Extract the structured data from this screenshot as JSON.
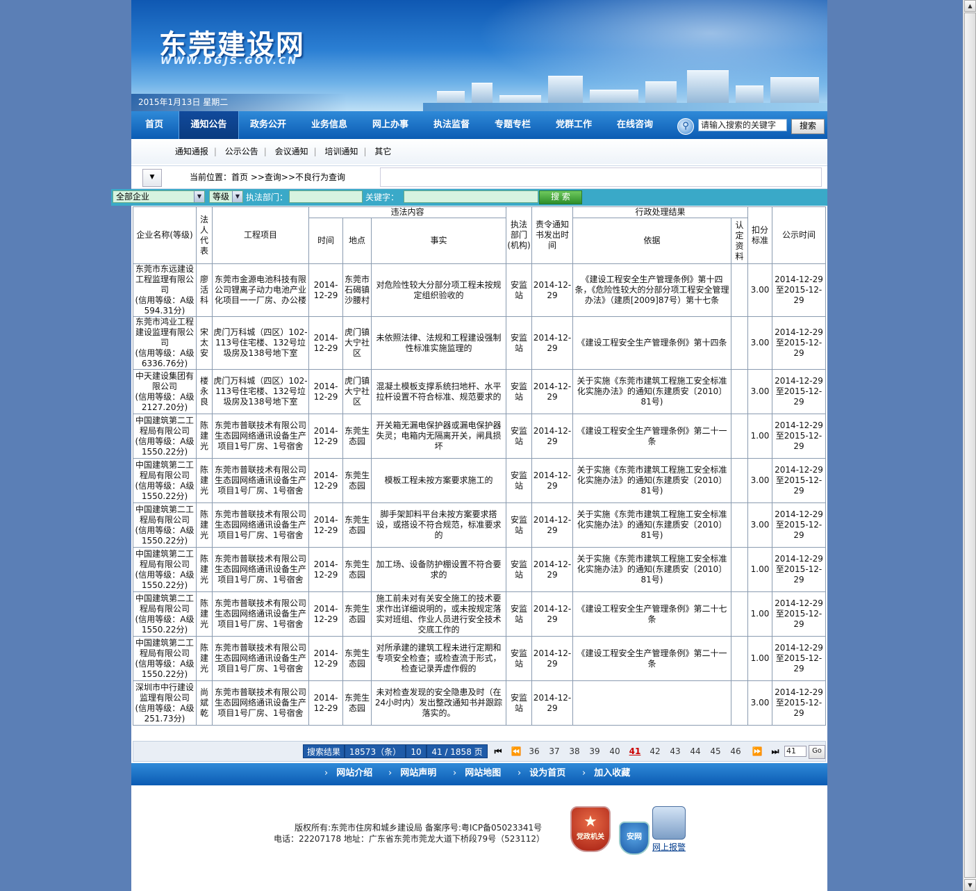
{
  "header": {
    "site_title": "东莞建设网",
    "site_url": "WWW.DGJS.GOV.CN",
    "date": "2015年1月13日 星期二"
  },
  "nav": {
    "items": [
      "首页",
      "通知公告",
      "政务公开",
      "业务信息",
      "网上办事",
      "执法监督",
      "专题专栏",
      "党群工作",
      "在线咨询"
    ],
    "active": "通知公告",
    "search_placeholder": "请输入搜索的关键字",
    "search_button": "搜索"
  },
  "subnav": {
    "items": [
      "通知通报",
      "公示公告",
      "会议通知",
      "培训通知",
      "其它"
    ]
  },
  "breadcrumb": {
    "text": "当前位置：首页 >>查询>>不良行为查询"
  },
  "filter": {
    "company_select": "全部企业",
    "grade_select": "等级",
    "dept_label": "执法部门：",
    "keyword_label": "关键字：",
    "search_button": "搜 索"
  },
  "table": {
    "headers": {
      "company": "企业名称(等级)",
      "legal_rep": "法人代表",
      "project": "工程项目",
      "violation": "违法内容",
      "time": "时间",
      "place": "地点",
      "fact": "事实",
      "dept": "执法部门(机构)",
      "notice_date": "责令通知书发出时间",
      "admin_result": "行政处理结果",
      "basis": "依据",
      "confirm": "认定资料",
      "deduct": "扣分标准",
      "publish": "公示时间"
    },
    "rows": [
      {
        "company": "东莞市东远建设工程监理有限公司",
        "grade": "(信用等级：A级594.31分)",
        "rep": "廖活科",
        "project": "东莞市金源电池科技有限公司锂离子动力电池产业化项目一一厂房、办公楼",
        "time": "2014-12-29",
        "place": "东莞市石碣镇沙腰村",
        "fact": "对危险性较大分部分项工程未按规定组织验收的",
        "dept": "安监站",
        "notice": "2014-12-29",
        "basis": "《建设工程安全生产管理条例》第十四条，《危险性较大的分部分项工程安全管理办法》（建质[2009]87号）第十七条",
        "confirm": "",
        "deduct": "3.00",
        "publish": "2014-12-29至2015-12-29"
      },
      {
        "company": "东莞市鸿业工程建设监理有限公司",
        "grade": "(信用等级：A级6336.76分)",
        "rep": "宋太安",
        "project": "虎门万科城（四区）102-113号住宅楼、132号垃圾房及138号地下室",
        "time": "2014-12-29",
        "place": "虎门镇大宁社区",
        "fact": "未依照法律、法规和工程建设强制性标准实施监理的",
        "dept": "安监站",
        "notice": "2014-12-29",
        "basis": "《建设工程安全生产管理条例》第十四条",
        "confirm": "",
        "deduct": "3.00",
        "publish": "2014-12-29至2015-12-29"
      },
      {
        "company": "中天建设集团有限公司",
        "grade": "(信用等级：A级2127.20分)",
        "rep": "楼永良",
        "project": "虎门万科城（四区）102-113号住宅楼、132号垃圾房及138号地下室",
        "time": "2014-12-29",
        "place": "虎门镇大宁社区",
        "fact": "混凝土模板支撑系统扫地杆、水平拉杆设置不符合标准、规范要求的",
        "dept": "安监站",
        "notice": "2014-12-29",
        "basis": "关于实施《东莞市建筑工程施工安全标准化实施办法》的通知(东建质安〔2010〕81号)",
        "confirm": "",
        "deduct": "3.00",
        "publish": "2014-12-29至2015-12-29"
      },
      {
        "company": "中国建筑第二工程局有限公司",
        "grade": "(信用等级：A级1550.22分)",
        "rep": "陈建光",
        "project": "东莞市普联技术有限公司生态园网络通讯设备生产项目1号厂房、1号宿舍",
        "time": "2014-12-29",
        "place": "东莞生态园",
        "fact": "开关箱无漏电保护器或漏电保护器失灵；电箱内无隔离开关，闸具损坏",
        "dept": "安监站",
        "notice": "2014-12-29",
        "basis": "《建设工程安全生产管理条例》第二十一条",
        "confirm": "",
        "deduct": "1.00",
        "publish": "2014-12-29至2015-12-29"
      },
      {
        "company": "中国建筑第二工程局有限公司",
        "grade": "(信用等级：A级1550.22分)",
        "rep": "陈建光",
        "project": "东莞市普联技术有限公司生态园网络通讯设备生产项目1号厂房、1号宿舍",
        "time": "2014-12-29",
        "place": "东莞生态园",
        "fact": "模板工程未按方案要求施工的",
        "dept": "安监站",
        "notice": "2014-12-29",
        "basis": "关于实施《东莞市建筑工程施工安全标准化实施办法》的通知(东建质安〔2010〕81号)",
        "confirm": "",
        "deduct": "3.00",
        "publish": "2014-12-29至2015-12-29"
      },
      {
        "company": "中国建筑第二工程局有限公司",
        "grade": "(信用等级：A级1550.22分)",
        "rep": "陈建光",
        "project": "东莞市普联技术有限公司生态园网络通讯设备生产项目1号厂房、1号宿舍",
        "time": "2014-12-29",
        "place": "东莞生态园",
        "fact": "脚手架卸料平台未按方案要求搭设，或搭设不符合规范，标准要求的",
        "dept": "安监站",
        "notice": "2014-12-29",
        "basis": "关于实施《东莞市建筑工程施工安全标准化实施办法》的通知(东建质安〔2010〕81号)",
        "confirm": "",
        "deduct": "3.00",
        "publish": "2014-12-29至2015-12-29"
      },
      {
        "company": "中国建筑第二工程局有限公司",
        "grade": "(信用等级：A级1550.22分)",
        "rep": "陈建光",
        "project": "东莞市普联技术有限公司生态园网络通讯设备生产项目1号厂房、1号宿舍",
        "time": "2014-12-29",
        "place": "东莞生态园",
        "fact": "加工场、设备防护棚设置不符合要求的",
        "dept": "安监站",
        "notice": "2014-12-29",
        "basis": "关于实施《东莞市建筑工程施工安全标准化实施办法》的通知(东建质安〔2010〕81号)",
        "confirm": "",
        "deduct": "1.00",
        "publish": "2014-12-29至2015-12-29"
      },
      {
        "company": "中国建筑第二工程局有限公司",
        "grade": "(信用等级：A级1550.22分)",
        "rep": "陈建光",
        "project": "东莞市普联技术有限公司生态园网络通讯设备生产项目1号厂房、1号宿舍",
        "time": "2014-12-29",
        "place": "东莞生态园",
        "fact": "施工前未对有关安全施工的技术要求作出详细说明的，或未按规定落实对班组、作业人员进行安全技术交底工作的",
        "dept": "安监站",
        "notice": "2014-12-29",
        "basis": "《建设工程安全生产管理条例》第二十七条",
        "confirm": "",
        "deduct": "1.00",
        "publish": "2014-12-29至2015-12-29"
      },
      {
        "company": "中国建筑第二工程局有限公司",
        "grade": "(信用等级：A级1550.22分)",
        "rep": "陈建光",
        "project": "东莞市普联技术有限公司生态园网络通讯设备生产项目1号厂房、1号宿舍",
        "time": "2014-12-29",
        "place": "东莞生态园",
        "fact": "对所承建的建筑工程未进行定期和专项安全检查；或检查流于形式，检查记录弄虚作假的",
        "dept": "安监站",
        "notice": "2014-12-29",
        "basis": "《建设工程安全生产管理条例》第二十一条",
        "confirm": "",
        "deduct": "1.00",
        "publish": "2014-12-29至2015-12-29"
      },
      {
        "company": "深圳市中行建设监理有限公司",
        "grade": "(信用等级：A级251.73分)",
        "rep": "尚斌乾",
        "project": "东莞市普联技术有限公司生态园网络通讯设备生产项目1号厂房、1号宿舍",
        "time": "2014-12-29",
        "place": "东莞生态园",
        "fact": "未对检查发现的安全隐患及时（在24小时内）发出整改通知书并跟踪落实的。",
        "dept": "安监站",
        "notice": "2014-12-29",
        "basis": "",
        "confirm": "",
        "deduct": "3.00",
        "publish": "2014-12-29至2015-12-29"
      }
    ]
  },
  "pager": {
    "label": "搜索结果",
    "total": "18573（条）",
    "per_page": "10",
    "position": "41 / 1858 页",
    "pages": [
      "36",
      "37",
      "38",
      "39",
      "40",
      "41",
      "42",
      "43",
      "44",
      "45",
      "46"
    ],
    "current": "41",
    "input_value": "41",
    "go": "Go"
  },
  "footer": {
    "links": [
      "网站介绍",
      "网站声明",
      "网站地图",
      "设为首页",
      "加入收藏"
    ],
    "line1": "版权所有:东莞市住房和城乡建设局    备案序号:粤ICP备05023341号",
    "line2": "电话：22207178    地址：广东省东莞市莞龙大道下桥段79号（523112）",
    "badge1": "党政机关",
    "badge2": "安网",
    "badge3": "网上报警"
  }
}
